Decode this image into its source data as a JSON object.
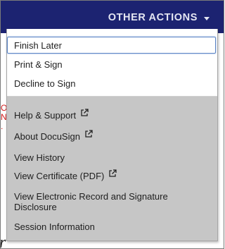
{
  "header": {
    "other_actions_label": "OTHER ACTIONS"
  },
  "background": {
    "partial_red_text": [
      "O",
      "N",
      "."
    ],
    "partial_text": "r"
  },
  "menu": {
    "primary_items": [
      {
        "label": "Finish Later"
      },
      {
        "label": "Print & Sign"
      },
      {
        "label": "Decline to Sign"
      }
    ],
    "secondary_items": [
      {
        "label": "Help & Support",
        "external": true
      },
      {
        "label": "About DocuSign",
        "external": true
      },
      {
        "label": "View History",
        "external": false
      },
      {
        "label": "View Certificate (PDF)",
        "external": true
      },
      {
        "label": "View Electronic Record and Signature Disclosure",
        "external": false
      },
      {
        "label": "Session Information",
        "external": false
      }
    ]
  },
  "colors": {
    "header_bg": "#1c2371",
    "menu_gray": "#c6c6c6",
    "focus_ring": "#5b84c4",
    "background_red_text": "#d01818"
  },
  "icons": {
    "dropdown": "caret-down-icon",
    "external": "external-link-icon"
  }
}
